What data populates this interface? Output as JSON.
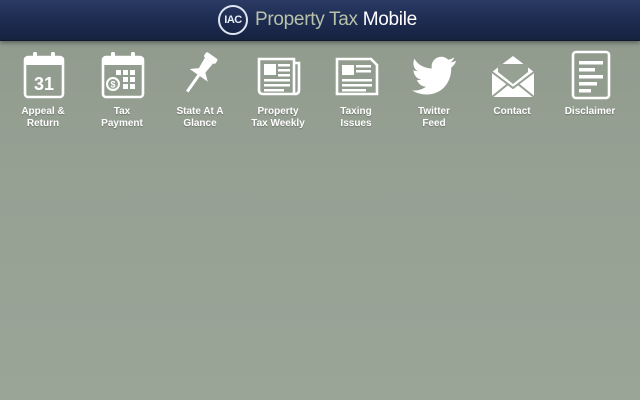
{
  "header": {
    "logo_text": "IAC",
    "title_part1": "Property Tax",
    "title_part2": "Mobile"
  },
  "colors": {
    "header_bg": "#1e2c52",
    "page_bg": "#96a093",
    "title_accent": "#b7c2a8",
    "icon_white": "#ffffff"
  },
  "menu": [
    {
      "icon": "calendar-31-icon",
      "day": "31",
      "label": "Appeal &\nReturn"
    },
    {
      "icon": "calendar-payment-icon",
      "label": "Tax\nPayment"
    },
    {
      "icon": "pushpin-icon",
      "label": "State At A\nGlance"
    },
    {
      "icon": "newspaper-icon",
      "label": "Property\nTax Weekly"
    },
    {
      "icon": "newspaper-single-icon",
      "label": "Taxing\nIssues"
    },
    {
      "icon": "twitter-bird-icon",
      "label": "Twitter\nFeed"
    },
    {
      "icon": "envelope-icon",
      "label": "Contact"
    },
    {
      "icon": "document-icon",
      "label": "Disclaimer"
    }
  ]
}
